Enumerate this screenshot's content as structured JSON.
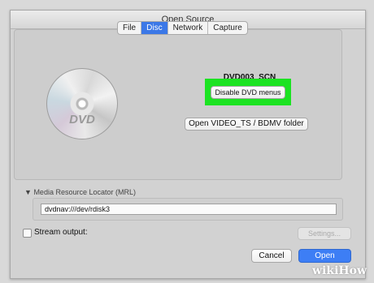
{
  "window": {
    "title": "Open Source"
  },
  "tabs": [
    {
      "label": "File",
      "active": false
    },
    {
      "label": "Disc",
      "active": true
    },
    {
      "label": "Network",
      "active": false
    },
    {
      "label": "Capture",
      "active": false
    }
  ],
  "disc": {
    "icon": "dvd-disc-icon",
    "logo_text": "DVD",
    "volume_name": "DVD003_SCN",
    "disable_menus_label": "Disable DVD menus",
    "open_folder_label": "Open VIDEO_TS / BDMV folder",
    "highlight_color": "#1ce322"
  },
  "mrl": {
    "section_label": "Media Resource Locator (MRL)",
    "value": "dvdnav:///dev/rdisk3"
  },
  "stream": {
    "label": "Stream output:",
    "checked": false,
    "settings_label": "Settings..."
  },
  "buttons": {
    "cancel_label": "Cancel",
    "open_label": "Open"
  },
  "accent_color": "#3d7ef5",
  "watermark": "wikiHow"
}
